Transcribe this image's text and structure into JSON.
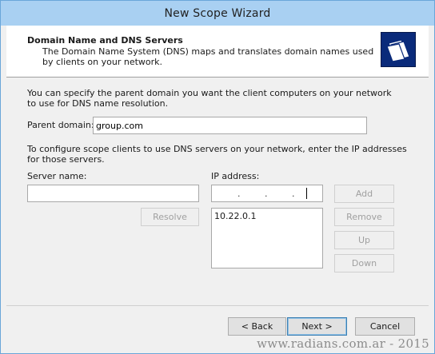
{
  "window": {
    "title": "New Scope Wizard"
  },
  "header": {
    "title": "Domain Name and DNS Servers",
    "subtitle": "The Domain Name System (DNS) maps and translates domain names used by clients on your network."
  },
  "intro_text": "You can specify the parent domain you want the client computers on your network to use for DNS name resolution.",
  "parent_domain": {
    "label": "Parent domain:",
    "value": "group.com"
  },
  "dns_text": "To configure scope clients to use DNS servers on your network, enter the IP addresses for those servers.",
  "server_name": {
    "label": "Server name:",
    "value": ""
  },
  "ip_address": {
    "label": "IP address:",
    "dot": "."
  },
  "ip_list": [
    "10.22.0.1"
  ],
  "buttons": {
    "resolve": "Resolve",
    "add": "Add",
    "remove": "Remove",
    "up": "Up",
    "down": "Down",
    "back": "< Back",
    "next": "Next >",
    "cancel": "Cancel"
  },
  "watermark": "www.radians.com.ar - 2015"
}
